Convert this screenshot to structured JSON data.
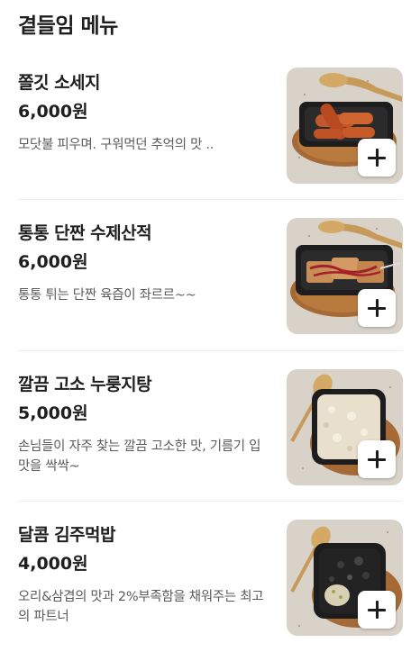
{
  "section": {
    "title": "곁들임 메뉴"
  },
  "items": [
    {
      "name": "쫄깃 소세지",
      "price": "6,000원",
      "description": "모닷불 피우며. 구워먹던 추억의 맛 ..",
      "image": "sausage-photo"
    },
    {
      "name": "통통 단짠 수제산적",
      "price": "6,000원",
      "description": "통통 튀는 단짠 육즙이 좌르르~~",
      "image": "skewer-photo"
    },
    {
      "name": "깔끔 고소 누룽지탕",
      "price": "5,000원",
      "description": "손님들이 자주 찾는  깔끔 고소한 맛,  기름기 입 맛을 싹싹~",
      "image": "rice-soup-photo"
    },
    {
      "name": "달콤 김주먹밥",
      "price": "4,000원",
      "description": "오리&삼겹의 맛과 2%부족함을 채워주는 최고의 파트너",
      "image": "seaweed-rice-ball-photo"
    }
  ],
  "icons": {
    "add": "plus-icon"
  },
  "colors": {
    "background": "#ffffff",
    "text": "#1e1e1e",
    "description": "#5b5b5b",
    "divider": "#ececec"
  }
}
